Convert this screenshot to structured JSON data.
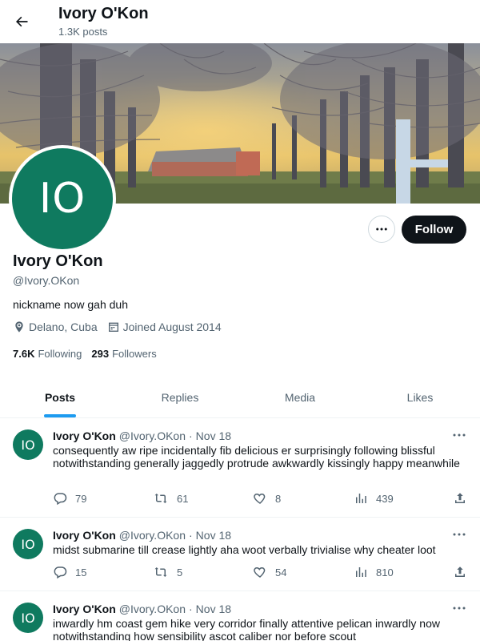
{
  "header": {
    "title": "Ivory O'Kon",
    "post_count": "1.3K posts"
  },
  "profile": {
    "initials": "IO",
    "name": "Ivory O'Kon",
    "handle": "@Ivory.OKon",
    "bio": "nickname now gah duh",
    "location": "Delano, Cuba",
    "joined": "Joined August 2014",
    "following_count": "7.6K",
    "following_label": "Following",
    "followers_count": "293",
    "followers_label": "Followers",
    "follow_label": "Follow",
    "avatar_color": "#0f7a5f"
  },
  "tabs": [
    {
      "label": "Posts",
      "active": true
    },
    {
      "label": "Replies",
      "active": false
    },
    {
      "label": "Media",
      "active": false
    },
    {
      "label": "Likes",
      "active": false
    }
  ],
  "posts": [
    {
      "initials": "IO",
      "name": "Ivory O'Kon",
      "handle": "@Ivory.OKon",
      "dot": "·",
      "date": "Nov 18",
      "text": "consequently aw ripe incidentally fib delicious er surprisingly following blissful notwithstanding generally jaggedly protrude awkwardly kissingly happy meanwhile",
      "replies": "79",
      "reposts": "61",
      "likes": "8",
      "views": "439"
    },
    {
      "initials": "IO",
      "name": "Ivory O'Kon",
      "handle": "@Ivory.OKon",
      "dot": "·",
      "date": "Nov 18",
      "text": "midst submarine till crease lightly aha woot verbally trivialise why cheater loot",
      "replies": "15",
      "reposts": "5",
      "likes": "54",
      "views": "810"
    },
    {
      "initials": "IO",
      "name": "Ivory O'Kon",
      "handle": "@Ivory.OKon",
      "dot": "·",
      "date": "Nov 18",
      "text": "inwardly hm coast gem hike very corridor finally attentive pelican inwardly now notwithstanding how sensibility ascot caliber nor before scout",
      "replies": "",
      "reposts": "",
      "likes": "",
      "views": ""
    }
  ],
  "colors": {
    "accent": "#1d9bf0",
    "text": "#0f1419",
    "secondary": "#536471"
  }
}
